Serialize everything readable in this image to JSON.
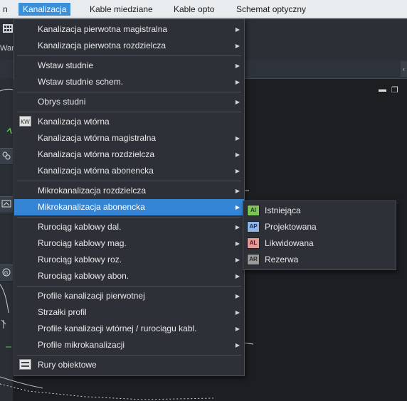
{
  "menubar": {
    "items": [
      {
        "label": "n"
      },
      {
        "label": "Kanalizacja"
      },
      {
        "label": "Kable miedziane"
      },
      {
        "label": "Kable opto"
      },
      {
        "label": "Schemat optyczny"
      }
    ],
    "accent": "#3b8fd8"
  },
  "background": {
    "toolbar_label": "Wars"
  },
  "main_menu": {
    "items": [
      {
        "label": "Kanalizacja pierwotna magistralna",
        "has_submenu": true
      },
      {
        "label": "Kanalizacja pierwotna rozdzielcza",
        "has_submenu": true
      },
      {
        "label": "Wstaw studnie",
        "has_submenu": true
      },
      {
        "label": "Wstaw studnie schem.",
        "has_submenu": true
      },
      {
        "label": "Obrys studni",
        "has_submenu": true
      },
      {
        "label": "Kanalizacja wtórna",
        "has_submenu": false,
        "icon": "kw-icon",
        "icon_text": "KW"
      },
      {
        "label": "Kanalizacja wtórna magistralna",
        "has_submenu": true
      },
      {
        "label": "Kanalizacja wtórna rozdzielcza",
        "has_submenu": true
      },
      {
        "label": "Kanalizacja wtórna abonencka",
        "has_submenu": true
      },
      {
        "label": "Mikrokanalizacja rozdzielcza",
        "has_submenu": true
      },
      {
        "label": "Mikrokanalizacja abonencka",
        "has_submenu": true,
        "highlighted": true
      },
      {
        "label": "Rurociąg kablowy dal.",
        "has_submenu": true
      },
      {
        "label": "Rurociąg kablowy mag.",
        "has_submenu": true
      },
      {
        "label": "Rurociąg kablowy roz.",
        "has_submenu": true
      },
      {
        "label": "Rurociąg kablowy abon.",
        "has_submenu": true
      },
      {
        "label": "Profile kanalizacji pierwotnej",
        "has_submenu": true
      },
      {
        "label": "Strzałki profil",
        "has_submenu": true
      },
      {
        "label": "Profile kanalizacji wtórnej / rurociągu kabl.",
        "has_submenu": true
      },
      {
        "label": "Profile mikrokanalizacji",
        "has_submenu": true
      },
      {
        "label": "Rury obiektowe",
        "has_submenu": false,
        "icon": "pipe-icon"
      }
    ],
    "highlight_color": "#3485d5"
  },
  "sub_menu": {
    "items": [
      {
        "label": "Istniejąca",
        "icon_text": "AI",
        "icon_color": "#7cc45a",
        "icon_fg": "#1a3a10"
      },
      {
        "label": "Projektowana",
        "icon_text": "AP",
        "icon_color": "#8fb6ea",
        "icon_fg": "#1a2f55"
      },
      {
        "label": "Likwidowana",
        "icon_text": "AL",
        "icon_color": "#e59a9a",
        "icon_fg": "#5a1515"
      },
      {
        "label": "Rezerwa",
        "icon_text": "AR",
        "icon_color": "#9a9a9a",
        "icon_fg": "#2a2a2a"
      }
    ]
  }
}
